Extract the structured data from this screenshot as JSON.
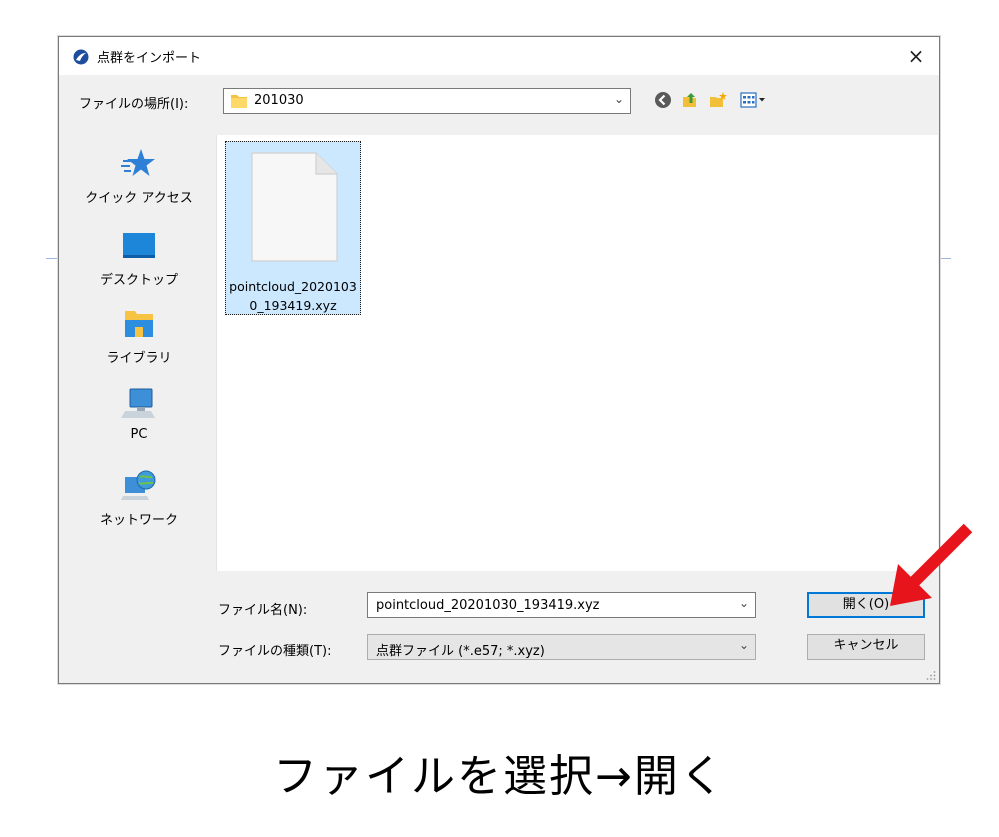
{
  "dialog": {
    "title": "点群をインポート",
    "close_label": "×",
    "look_in_label": "ファイルの場所(I):",
    "look_in_value": "201030",
    "places": [
      {
        "label": "クイック アクセス",
        "icon": "star-icon"
      },
      {
        "label": "デスクトップ",
        "icon": "desktop-icon"
      },
      {
        "label": "ライブラリ",
        "icon": "library-icon"
      },
      {
        "label": "PC",
        "icon": "computer-icon"
      },
      {
        "label": "ネットワーク",
        "icon": "network-icon"
      }
    ],
    "files": [
      {
        "name": "pointcloud_20201030_193419.xyz",
        "selected": true
      }
    ],
    "file_name_label": "ファイル名(N):",
    "file_name_value": "pointcloud_20201030_193419.xyz",
    "file_type_label": "ファイルの種類(T):",
    "file_type_value": "点群ファイル (*.e57; *.xyz)",
    "open_label": "開く(O)",
    "cancel_label": "キャンセル"
  },
  "caption": "ファイルを選択→開く",
  "colors": {
    "selection": "#cce8ff",
    "focus_border": "#0078d7",
    "arrow": "#e8141c"
  }
}
